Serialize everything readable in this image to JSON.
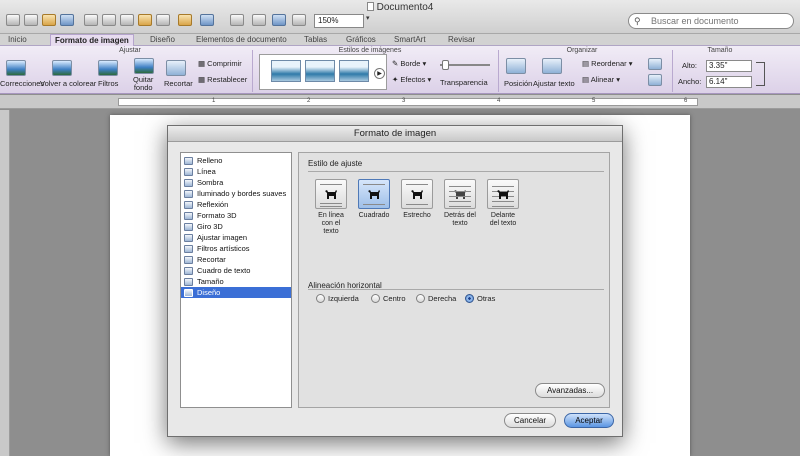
{
  "window": {
    "title": "Documento4"
  },
  "toolbar": {
    "zoom": "150%",
    "search_placeholder": "Buscar en documento"
  },
  "tabs": [
    "Inicio",
    "Formato de imagen",
    "Diseño",
    "Elementos de documento",
    "Tablas",
    "Gráficos",
    "SmartArt",
    "Revisar"
  ],
  "ribbon": {
    "groups": {
      "ajustar": "Ajustar",
      "estilos": "Estilos de imágenes",
      "organizar": "Organizar",
      "tamano": "Tamaño"
    },
    "buttons": {
      "correcciones": "Correcciones",
      "volver": "Volver a colorear",
      "filtros": "Filtros",
      "quitar_1": "Quitar",
      "quitar_2": "fondo",
      "recortar": "Recortar",
      "comprimir": "Comprimir",
      "restablecer": "Restablecer",
      "borde": "Borde",
      "efectos": "Efectos",
      "transparencia": "Transparencia",
      "posicion": "Posición",
      "ajustar_texto": "Ajustar texto",
      "reordenar": "Reordenar",
      "alinear": "Alinear"
    },
    "size": {
      "alto_label": "Alto:",
      "alto": "3.35\"",
      "ancho_label": "Ancho:",
      "ancho": "6.14\""
    }
  },
  "ruler": [
    "1",
    "2",
    "3",
    "4",
    "5",
    "6"
  ],
  "dialog": {
    "title": "Formato de imagen",
    "categories": [
      "Relleno",
      "Línea",
      "Sombra",
      "Iluminado y bordes suaves",
      "Reflexión",
      "Formato 3D",
      "Giro 3D",
      "Ajustar imagen",
      "Filtros artísticos",
      "Recortar",
      "Cuadro de texto",
      "Tamaño",
      "Diseño"
    ],
    "selected_category": "Diseño",
    "wrap_section": "Estilo de ajuste",
    "wrap_options": [
      {
        "line1": "En línea",
        "line2": "con el",
        "line3": "texto"
      },
      {
        "line1": "Cuadrado",
        "line2": "",
        "line3": ""
      },
      {
        "line1": "Estrecho",
        "line2": "",
        "line3": ""
      },
      {
        "line1": "Detrás del",
        "line2": "texto",
        "line3": ""
      },
      {
        "line1": "Delante",
        "line2": "del texto",
        "line3": ""
      }
    ],
    "selected_wrap": "Cuadrado",
    "align_section": "Alineación horizontal",
    "align_options": [
      "Izquierda",
      "Centro",
      "Derecha",
      "Otras"
    ],
    "selected_align": "Otras",
    "advanced_button": "Avanzadas...",
    "cancel_button": "Cancelar",
    "ok_button": "Aceptar"
  },
  "colors": {
    "accent": "#3b6fd6",
    "ribbon": "#e7dcef"
  }
}
